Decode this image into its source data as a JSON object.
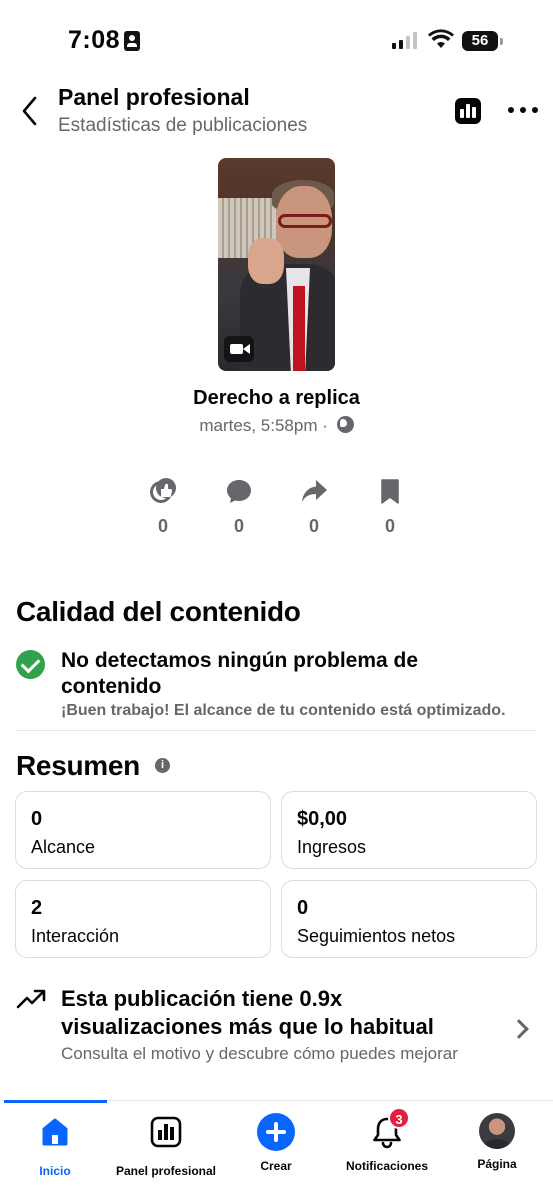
{
  "status_bar": {
    "time": "7:08",
    "battery": "56"
  },
  "header": {
    "title": "Panel profesional",
    "subtitle": "Estadísticas de publicaciones"
  },
  "post": {
    "title": "Derecho a replica",
    "meta": "martes, 5:58pm ·"
  },
  "engagement": [
    {
      "icon": "reactions-icon",
      "value": "0"
    },
    {
      "icon": "comment-icon",
      "value": "0"
    },
    {
      "icon": "share-icon",
      "value": "0"
    },
    {
      "icon": "bookmark-icon",
      "value": "0"
    }
  ],
  "quality": {
    "title": "Calidad del contenido",
    "headline": "No detectamos ningún problema de contenido",
    "subtext": "¡Buen trabajo! El alcance de tu contenido está optimizado."
  },
  "summary": {
    "title": "Resumen",
    "info": "i",
    "cards": [
      {
        "value": "0",
        "label": "Alcance"
      },
      {
        "value": "$0,00",
        "label": "Ingresos"
      },
      {
        "value": "2",
        "label": "Interacción"
      },
      {
        "value": "0",
        "label": "Seguimientos netos"
      }
    ]
  },
  "insight": {
    "title": "Esta publicación tiene 0.9x visualizaciones más que lo habitual",
    "subtitle": "Consulta el motivo y descubre cómo puedes mejorar"
  },
  "bottom_nav": {
    "items": [
      {
        "label": "Inicio",
        "active": true
      },
      {
        "label": "Panel profesional"
      },
      {
        "label": "Crear"
      },
      {
        "label": "Notificaciones",
        "badge": "3"
      },
      {
        "label": "Página"
      }
    ]
  },
  "colors": {
    "accent": "#0866ff",
    "success": "#31a24c",
    "badge": "#e41e3f",
    "secondary_text": "#65676b"
  }
}
